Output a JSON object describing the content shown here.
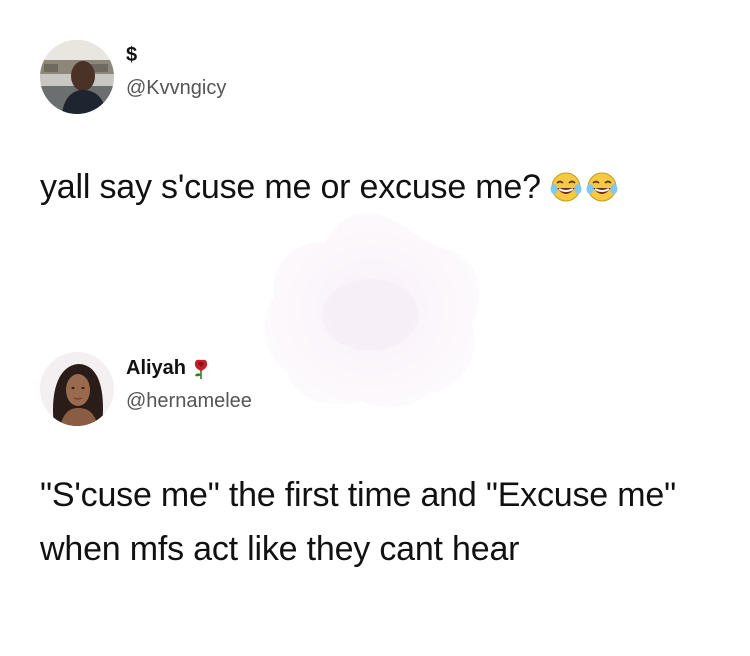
{
  "tweets": [
    {
      "display_name": "$",
      "handle": "@Kvvngicy",
      "text": "yall say s'cuse me or excuse me?",
      "emoji_icons": [
        "face-with-tears-of-joy-icon",
        "face-with-tears-of-joy-icon"
      ]
    },
    {
      "display_name": "Aliyah",
      "name_icon": "rose-icon",
      "handle": "@hernamelee",
      "text": "\"S'cuse me\" the first time and \"Excuse me\" when mfs act like they cant hear"
    }
  ],
  "colors": {
    "text": "#111111",
    "handle": "#555555",
    "background": "#ffffff",
    "rose": "#c0202a"
  }
}
